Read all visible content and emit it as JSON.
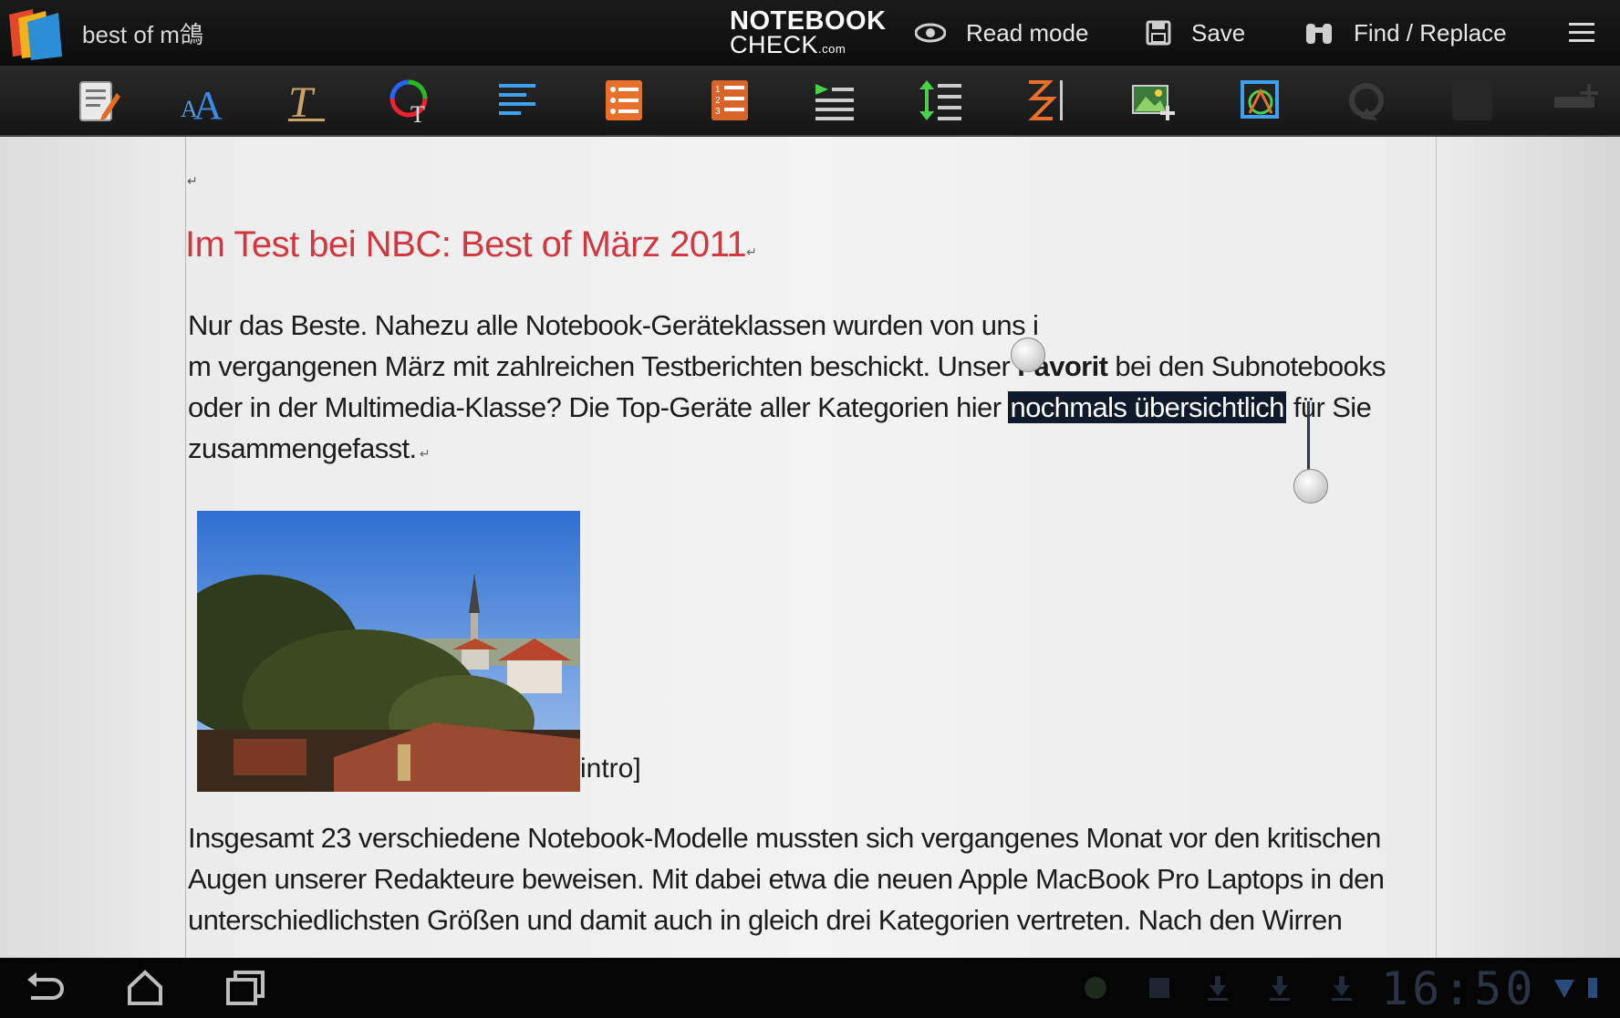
{
  "actionbar": {
    "doc_title": "best of m鴿",
    "logo_line1": "NOTEBOOK",
    "logo_line2": "CHECK",
    "logo_suffix": ".com",
    "read_mode_label": "Read mode",
    "save_label": "Save",
    "find_replace_label": "Find / Replace"
  },
  "toolbar": {
    "tools": [
      "edit-note-icon",
      "font-size-icon",
      "text-style-icon",
      "text-color-icon",
      "align-icon",
      "bullet-list-icon",
      "numbered-list-icon",
      "indent-icon",
      "line-spacing-icon",
      "page-break-icon",
      "insert-image-icon",
      "image-frame-icon",
      "undo-icon",
      "blank-tool-icon",
      "table-icon"
    ]
  },
  "document": {
    "heading": "Im Test bei NBC: Best of März 2011",
    "para1_part1": "Nur das Beste. Nahezu alle Notebook-Geräteklassen wurden von uns i",
    "para1_part2": "m vergangenen März mit zahlreichen Testberichten beschickt. Unser ",
    "para1_bold": "Favorit",
    "para1_part3": " bei den Subnotebooks oder in der Multimedia-Klasse? Die Top-Geräte aller Kategorien hier ",
    "para1_selected": "nochmals übersichtlich",
    "para1_part4": " für Sie zusammengefasst.",
    "caption": "intro]",
    "para2": "Insgesamt 23 verschiedene Notebook-Modelle mussten sich vergangenes Monat vor den kritischen Augen unserer Redakteure beweisen. Mit dabei etwa die neuen Apple MacBook Pro Laptops in den unterschiedlichsten Größen und damit auch in gleich drei Kategorien vertreten. Nach den Wirren"
  },
  "systembar": {
    "clock": "16:50"
  },
  "colors": {
    "heading": "#d0373f",
    "selection": "#0f1a2c"
  }
}
